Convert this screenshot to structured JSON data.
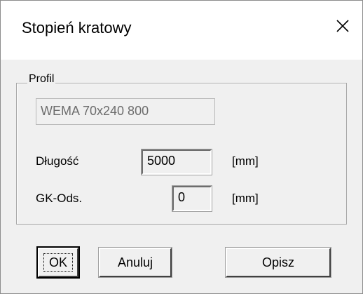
{
  "window": {
    "title": "Stopień kratowy",
    "close_icon": "close-icon"
  },
  "profile_group": {
    "label": "Profil",
    "value": "WEMA 70x240 800"
  },
  "fields": {
    "dlugosc": {
      "label": "Długość",
      "value": "5000",
      "unit": "[mm]"
    },
    "gk_ods": {
      "label": "GK-Ods.",
      "value": "0",
      "unit": "[mm]"
    }
  },
  "buttons": {
    "ok": "OK",
    "anuluj": "Anuluj",
    "opisz": "Opisz"
  }
}
